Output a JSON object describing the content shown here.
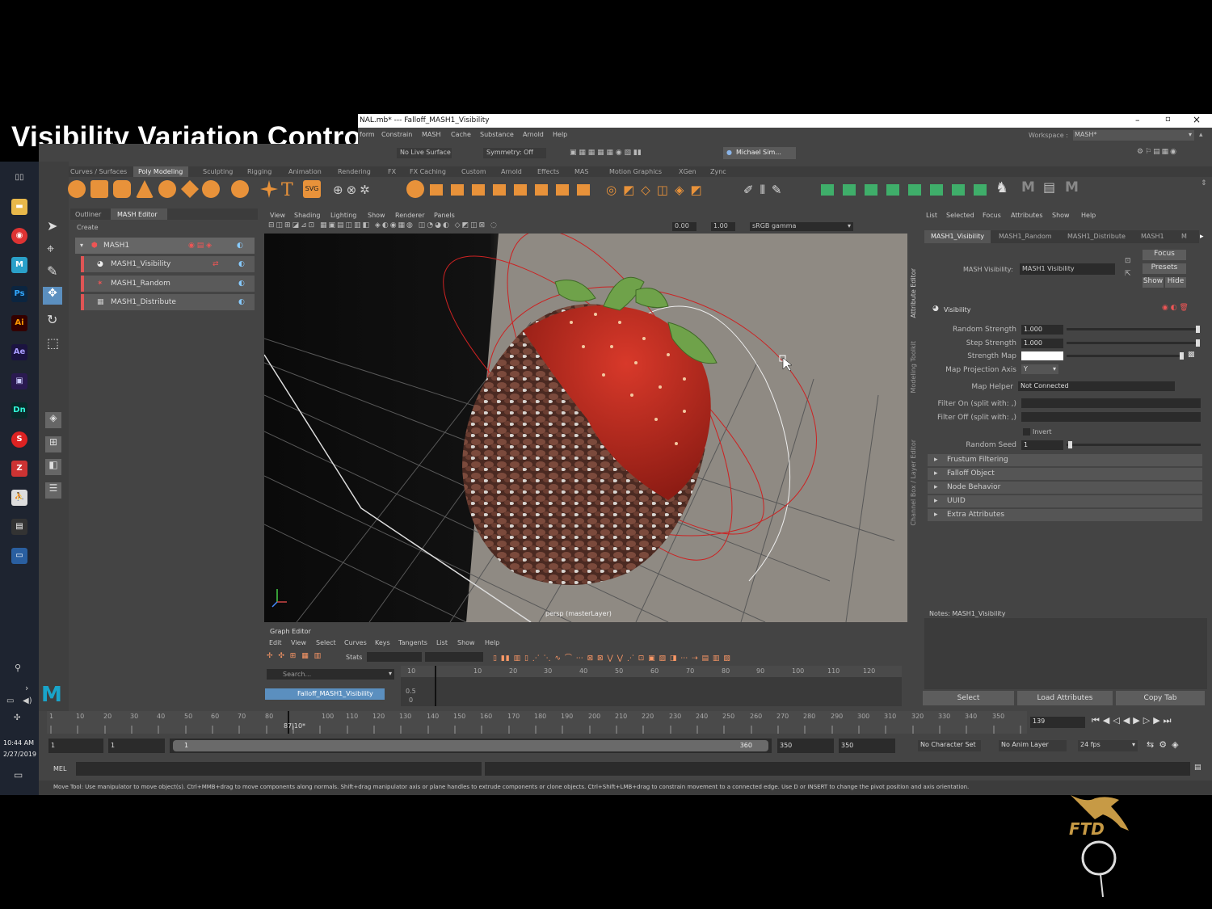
{
  "caption": "Visibility Variation Control",
  "window": {
    "title": "NAL.mb*  ---  Falloff_MASH1_Visibility",
    "menus": [
      "form",
      "Constrain",
      "MASH",
      "Cache",
      "Substance",
      "Arnold",
      "Help"
    ],
    "workspace_label": "Workspace :",
    "workspace_value": "MASH*",
    "no_live_surface": "No Live Surface",
    "symmetry": "Symmetry: Off",
    "user": "Michael Sim..."
  },
  "shelf": {
    "tabs": [
      "Curves / Surfaces",
      "Poly Modeling",
      "Sculpting",
      "Rigging",
      "Animation",
      "Rendering",
      "FX",
      "FX Caching",
      "Custom",
      "Arnold",
      "Effects",
      "MAS",
      "Motion Graphics",
      "XGen",
      "Zync"
    ],
    "active_tab": "Poly Modeling"
  },
  "outliner": {
    "tabs": [
      "Outliner",
      "MASH Editor"
    ],
    "create": "Create",
    "items": [
      "MASH1",
      "MASH1_Visibility",
      "MASH1_Random",
      "MASH1_Distribute"
    ]
  },
  "viewport": {
    "menus": [
      "View",
      "Shading",
      "Lighting",
      "Show",
      "Renderer",
      "Panels"
    ],
    "field1": "0.00",
    "field2": "1.00",
    "color_space": "sRGB gamma",
    "camera_label": "persp (masterLayer)"
  },
  "graph_editor": {
    "title": "Graph Editor",
    "menus": [
      "Edit",
      "View",
      "Select",
      "Curves",
      "Keys",
      "Tangents",
      "List",
      "Show",
      "Help"
    ],
    "stats": "Stats",
    "search": "Search...",
    "item": "Falloff_MASH1_Visibility",
    "ruler": [
      "10",
      "10",
      "20",
      "30",
      "40",
      "50",
      "60",
      "70",
      "80",
      "90",
      "100",
      "110",
      "120"
    ],
    "yvals": [
      "0.5",
      "0"
    ]
  },
  "attribute_editor": {
    "menus": [
      "List",
      "Selected",
      "Focus",
      "Attributes",
      "Show",
      "Help"
    ],
    "tabs": [
      "MASH1_Visibility",
      "MASH1_Random",
      "MASH1_Distribute",
      "MASH1",
      "M"
    ],
    "node_label": "MASH Visibility:",
    "node_name": "MASH1 Visibility",
    "focus": "Focus",
    "presets": "Presets",
    "show": "Show",
    "hide": "Hide",
    "section": "Visibility",
    "rows": [
      {
        "label": "Random Strength",
        "value": "1.000"
      },
      {
        "label": "Step Strength",
        "value": "1.000"
      },
      {
        "label": "Strength Map",
        "value": ""
      },
      {
        "label": "Map Projection Axis",
        "value": "Y"
      },
      {
        "label": "Map Helper",
        "value": "Not Connected"
      },
      {
        "label": "Filter On (split with: ,)",
        "value": ""
      },
      {
        "label": "Filter Off (split with: ,)",
        "value": ""
      },
      {
        "label": "Random Seed",
        "value": "1"
      }
    ],
    "invert": "Invert",
    "collapsed": [
      "Frustum Filtering",
      "Falloff Object",
      "Node Behavior",
      "UUID",
      "Extra Attributes"
    ],
    "notes": "Notes:  MASH1_Visibility",
    "buttons": [
      "Select",
      "Load Attributes",
      "Copy Tab"
    ],
    "side_tabs": [
      "Attribute Editor",
      "Modeling Toolkit",
      "Channel Box / Layer Editor"
    ]
  },
  "timeline": {
    "ticks": [
      "10",
      "20",
      "30",
      "40",
      "50",
      "60",
      "70",
      "80",
      "90",
      "100",
      "110",
      "120",
      "130",
      "140",
      "150",
      "160",
      "170",
      "180",
      "190",
      "200",
      "210",
      "220",
      "230",
      "240",
      "250",
      "260",
      "270",
      "280",
      "290",
      "300",
      "310",
      "320",
      "330",
      "340",
      "350"
    ],
    "first_tick": "1",
    "current_marker": "87|10*",
    "current_frame": "139",
    "range_start": "1",
    "range_start2": "1",
    "range_slider_start": "1",
    "range_slider_end": "360",
    "range_end": "350",
    "range_end2": "350",
    "char_set": "No Character Set",
    "anim_layer": "No Anim Layer",
    "fps": "24 fps"
  },
  "command": {
    "mel": "MEL",
    "help": "Move Tool: Use manipulator to move object(s). Ctrl+MMB+drag to move components along normals. Shift+drag manipulator axis or plane handles to extrude components or clone objects. Ctrl+Shift+LMB+drag to constrain movement to a connected edge. Use D or INSERT to change the pivot position and axis orientation."
  },
  "taskbar": {
    "time": "10:44 AM",
    "date": "2/27/2019"
  },
  "watermark": "FTD",
  "colors": {
    "accent": "#5a9fd4",
    "maya_panel": "#444444",
    "strawberry_red": "#c0281e",
    "chocolate": "#6b3a2e",
    "selection_red": "#e05555"
  }
}
